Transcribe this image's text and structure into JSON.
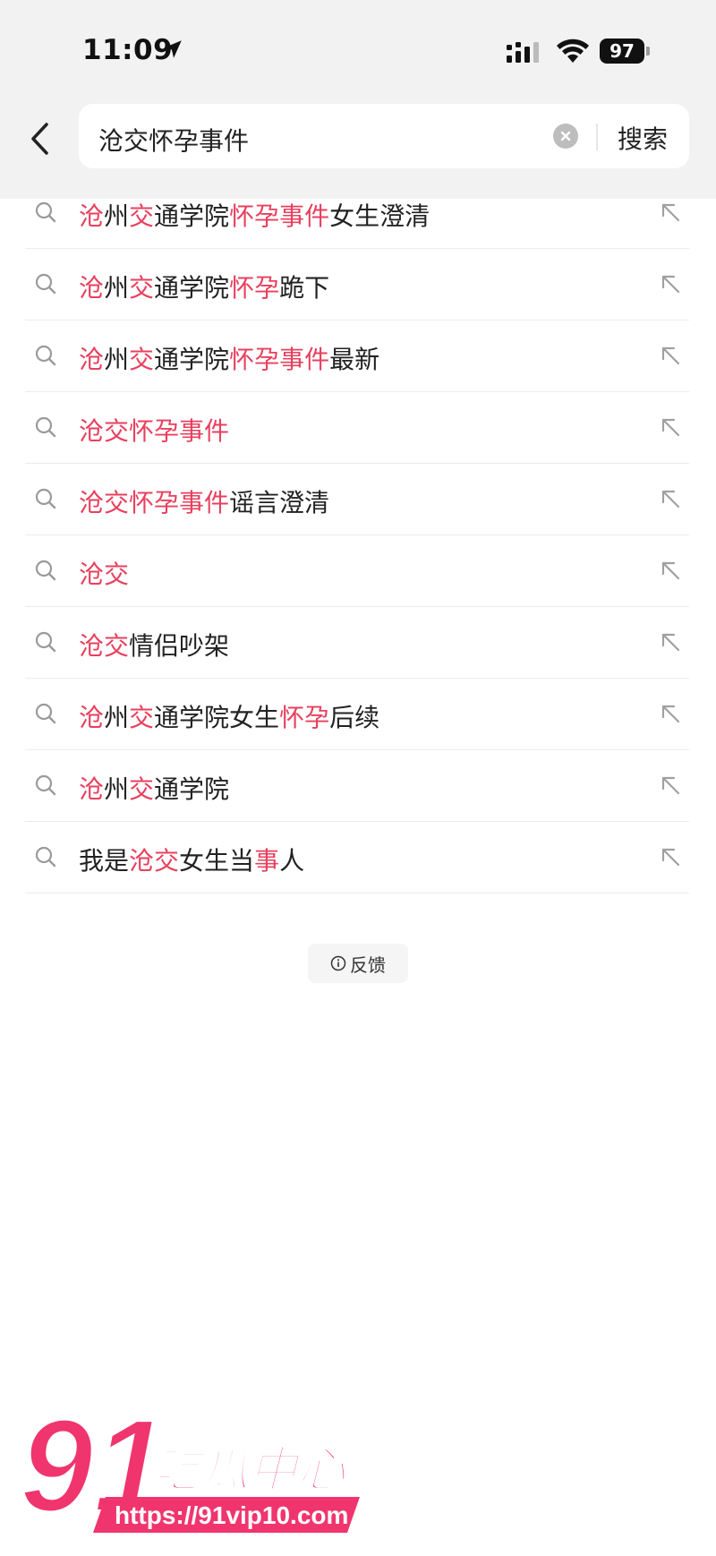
{
  "status_bar": {
    "time": "11:09",
    "battery": "97"
  },
  "search": {
    "query": "沧交怀孕事件",
    "submit_label": "搜索"
  },
  "suggestions": [
    {
      "segments": [
        {
          "t": "沧",
          "hl": true
        },
        {
          "t": "州",
          "hl": false
        },
        {
          "t": "交",
          "hl": true
        },
        {
          "t": "通学院",
          "hl": false
        },
        {
          "t": "怀孕事件",
          "hl": true
        },
        {
          "t": "女生澄清",
          "hl": false
        }
      ]
    },
    {
      "segments": [
        {
          "t": "沧",
          "hl": true
        },
        {
          "t": "州",
          "hl": false
        },
        {
          "t": "交",
          "hl": true
        },
        {
          "t": "通学院",
          "hl": false
        },
        {
          "t": "怀孕",
          "hl": true
        },
        {
          "t": "跪下",
          "hl": false
        }
      ]
    },
    {
      "segments": [
        {
          "t": "沧",
          "hl": true
        },
        {
          "t": "州",
          "hl": false
        },
        {
          "t": "交",
          "hl": true
        },
        {
          "t": "通学院",
          "hl": false
        },
        {
          "t": "怀孕事件",
          "hl": true
        },
        {
          "t": "最新",
          "hl": false
        }
      ]
    },
    {
      "segments": [
        {
          "t": "沧交怀孕事件",
          "hl": true
        }
      ]
    },
    {
      "segments": [
        {
          "t": "沧交怀孕事件",
          "hl": true
        },
        {
          "t": "谣言澄清",
          "hl": false
        }
      ]
    },
    {
      "segments": [
        {
          "t": "沧交",
          "hl": true
        }
      ]
    },
    {
      "segments": [
        {
          "t": "沧交",
          "hl": true
        },
        {
          "t": "情侣吵架",
          "hl": false
        }
      ]
    },
    {
      "segments": [
        {
          "t": "沧",
          "hl": true
        },
        {
          "t": "州",
          "hl": false
        },
        {
          "t": "交",
          "hl": true
        },
        {
          "t": "通学院女生",
          "hl": false
        },
        {
          "t": "怀孕",
          "hl": true
        },
        {
          "t": "后续",
          "hl": false
        }
      ]
    },
    {
      "segments": [
        {
          "t": "沧",
          "hl": true
        },
        {
          "t": "州",
          "hl": false
        },
        {
          "t": "交",
          "hl": true
        },
        {
          "t": "通学院",
          "hl": false
        }
      ]
    },
    {
      "segments": [
        {
          "t": "我是",
          "hl": false
        },
        {
          "t": "沧交",
          "hl": true
        },
        {
          "t": "女生当",
          "hl": false
        },
        {
          "t": "事",
          "hl": true
        },
        {
          "t": "人",
          "hl": false
        }
      ]
    }
  ],
  "feedback_label": "反馈",
  "watermark": {
    "number": "91",
    "brand": "吃瓜中心",
    "url": "https://91vip10.com"
  },
  "colors": {
    "highlight": "#e8405e",
    "header_bg": "#f2f2f2",
    "watermark_pink": "#f0356e"
  }
}
